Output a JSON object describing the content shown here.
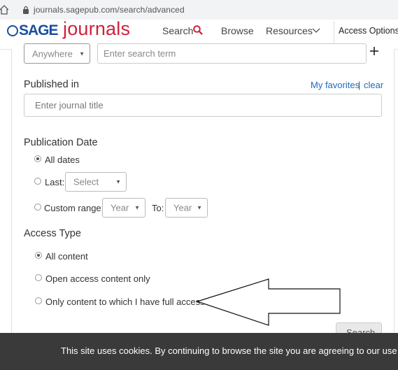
{
  "browser": {
    "url": "journals.sagepub.com/search/advanced"
  },
  "header": {
    "logo_sage": "SAGE",
    "logo_journals": "journals",
    "nav": {
      "search": "Search",
      "browse": "Browse",
      "resources": "Resources",
      "access": "Access Options:"
    }
  },
  "search_row": {
    "field_select": "Anywhere",
    "term_placeholder": "Enter search term"
  },
  "published_in": {
    "label": "Published in",
    "favorites_link": "My favorites",
    "separator": "|",
    "clear_link": "clear",
    "placeholder": "Enter journal title"
  },
  "publication_date": {
    "label": "Publication Date",
    "options": [
      {
        "label": "All dates",
        "checked": true
      },
      {
        "label": "Last:",
        "checked": false,
        "select": "Select"
      },
      {
        "label": "Custom range:",
        "checked": false,
        "from_select": "Year",
        "to_label": "To:",
        "to_select": "Year"
      }
    ]
  },
  "access_type": {
    "label": "Access Type",
    "options": [
      {
        "label": "All content",
        "checked": true
      },
      {
        "label": "Open access content only",
        "checked": false
      },
      {
        "label": "Only content to which I have full access",
        "checked": false
      }
    ]
  },
  "search_button": "Search",
  "cookie_banner": {
    "text": "This site uses cookies. By continuing to browse the site you are agreeing to our use of cookies."
  },
  "colors": {
    "brand_blue": "#1a4fa0",
    "brand_red": "#d02139",
    "link": "#1c6bbd",
    "banner": "#3a3a3a"
  }
}
